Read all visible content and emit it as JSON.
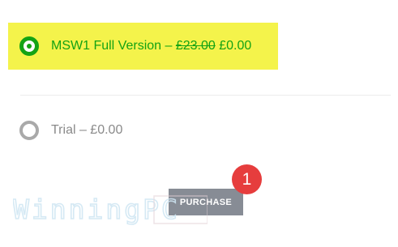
{
  "options": [
    {
      "label_prefix": "MSW1 Full Version – ",
      "old_price": "£23.00",
      "price_sep": " ",
      "price": "£0.00",
      "selected": true
    },
    {
      "label": "Trial – £0.00",
      "selected": false
    }
  ],
  "purchase_button": {
    "label": "PURCHASE"
  },
  "step_badge": {
    "number": "1"
  },
  "watermark": {
    "text": "WinningPC"
  },
  "colors": {
    "highlight": "#f4f34b",
    "accent": "#14a314",
    "muted": "#a9a9a9",
    "button": "#878c95",
    "badge": "#e63d3d",
    "watermark": "#cfe6f3"
  }
}
